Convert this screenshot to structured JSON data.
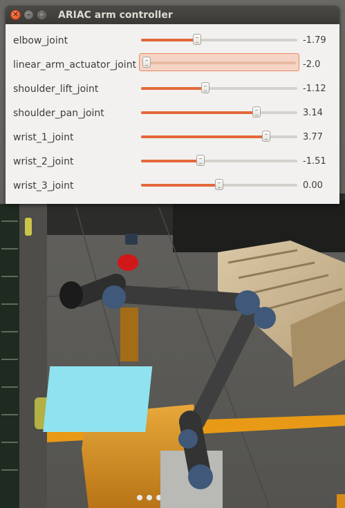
{
  "window": {
    "title": "ARIAC arm controller"
  },
  "joints": [
    {
      "name": "elbow_joint",
      "value": "-1.79",
      "level": 0.36,
      "focused": false
    },
    {
      "name": "linear_arm_actuator_joint",
      "value": "-2.0",
      "level": 0.0,
      "focused": true
    },
    {
      "name": "shoulder_lift_joint",
      "value": "-1.12",
      "level": 0.41,
      "focused": false
    },
    {
      "name": "shoulder_pan_joint",
      "value": "3.14",
      "level": 0.74,
      "focused": false
    },
    {
      "name": "wrist_1_joint",
      "value": "3.77",
      "level": 0.8,
      "focused": false
    },
    {
      "name": "wrist_2_joint",
      "value": "-1.51",
      "level": 0.38,
      "focused": false
    },
    {
      "name": "wrist_3_joint",
      "value": "0.00",
      "level": 0.5,
      "focused": false
    }
  ],
  "colors": {
    "accent": "#e4683a",
    "titlebar": "#3c3b37",
    "close_button": "#dd4814"
  }
}
